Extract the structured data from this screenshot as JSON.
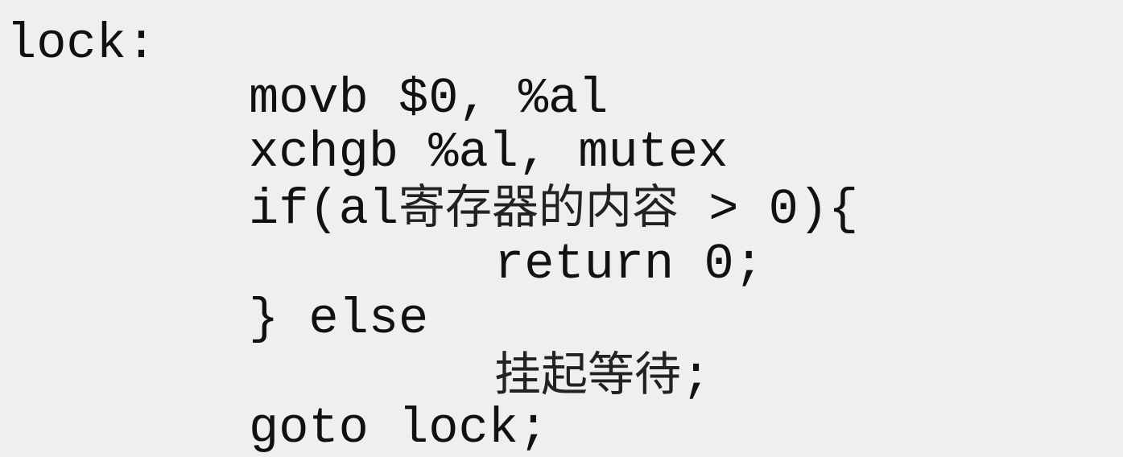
{
  "code": {
    "label_line": "lock:",
    "movb_line": "movb $0, %al",
    "xchgb_line": "xchgb %al, mutex",
    "if_line": {
      "prefix": "if(al",
      "cjk": "寄存器的内容",
      "suffix": " > 0){"
    },
    "return_line": "return 0;",
    "else_line": "} else",
    "suspend_line": {
      "cjk": "挂起等待",
      "suffix": ";"
    },
    "goto_line": "goto lock;"
  },
  "colors": {
    "background": "#efefef",
    "text": "#111111"
  }
}
